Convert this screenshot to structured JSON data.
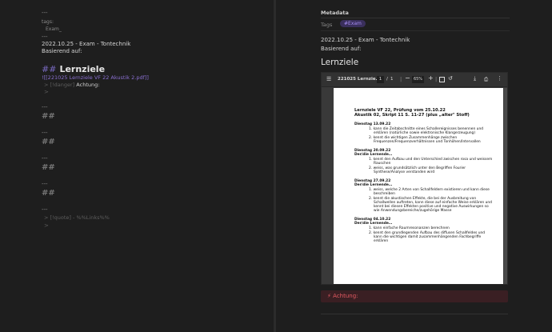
{
  "editor": {
    "frontmatter_open": "---",
    "tags_key": "tags:",
    "tags_value": "Exam_",
    "frontmatter_close": "---",
    "title_line": "2022.10.25 - Exam - Tontechnik",
    "based_on": "Basierend auf:",
    "heading_marker": "##",
    "heading_text": "Lernziele",
    "embed_link": "![[221025 Lernziele VF 22 Akustik 2.pdf]]",
    "callout_prefix": "> [!danger]",
    "callout_text": "Achtung:",
    "callout_cont": ">",
    "sections": [
      {
        "sep": "---",
        "hash": "##"
      },
      {
        "sep": "---",
        "hash": "##"
      },
      {
        "sep": "---",
        "hash": "##"
      },
      {
        "sep": "---",
        "hash": "##"
      },
      {
        "sep": "---",
        "hash": "##"
      }
    ],
    "last_sep": "---",
    "quote_line": "> [!quote] - %%Links%%",
    "quote_cont": ">"
  },
  "preview": {
    "metadata_title": "Metadata",
    "tags_label": "Tags",
    "tag": "#Exam",
    "title_line": "2022.10.25 - Exam - Tontechnik",
    "based_on": "Basierend auf:",
    "heading": "Lernziele",
    "pdf_toolbar": {
      "filename": "221025 Lernzie...",
      "page_current": "1",
      "page_sep": "/",
      "page_total": "1",
      "zoom": "65%"
    },
    "pdf_page": {
      "title1": "Lernziele VF 22, Prüfung vom 25.10.22",
      "title2": "Akustik 02, Skript 11 S. 11-27 (plus „alter\" Stoff)",
      "d1": "Dienstag 13.09.22",
      "d1_i1a": "1.   kann die Zeitabschnitte eines Schallereignisses benennen und",
      "d1_i1b": "erklären (natürliche sowie elektronische Klangerzeugung)",
      "d1_i2a": "2.   kennt die wichtigen Zusammenhänge zwischen",
      "d1_i2b": "Frequenzen/Frequenzverhältnissen und Tonhöhen/Intervallen",
      "d2": "Dienstag 20.09.22",
      "d2_sub": "Der/die Lernende…",
      "d2_i1a": "1.   kennt den Aufbau und den Unterschied zwischen rosa und weissem",
      "d2_i1b": "Rauschen",
      "d2_i2a": "2.   weiss, was grundsätzlich unter den Begriffen Fourier",
      "d2_i2b": "Synthese/Analyse verstanden wird",
      "d3": "Dienstag 27.09.22",
      "d3_sub": "Der/die Lernende…",
      "d3_i1a": "1.   weiss, welche 2 Arten von Schallfeldern existieren und kann diese",
      "d3_i1b": "beschreiben",
      "d3_i2a": "2.   kennt die akustischen Effekte, die bei der Ausbreitung von",
      "d3_i2b": "Schallwellen auftreten, kann diese auf einfache Weise erklären und",
      "d3_i2c": "kennt bei diesen Effekten positive und negative Auswirkungen so",
      "d3_i2d": "wie Anwendungsbereiche/zugehörige Masse",
      "d4": "Dienstag 04.10.22",
      "d4_sub": "Der/die Lernende…",
      "d4_i1a": "1.   kann einfache Raumresonanzen berechnen",
      "d4_i2a": "2.   kennt den grundlegenden Aufbau des diffusen Schallfeldes und",
      "d4_i2b": "kann die wichtigen damit zusammenhängenden Fachbegriffe",
      "d4_i2c": "erklären"
    },
    "callout_label": "Achtung:"
  },
  "colors": {
    "accent": "#8a6fd1",
    "danger": "#e45a62",
    "background": "#1e1e1e"
  }
}
